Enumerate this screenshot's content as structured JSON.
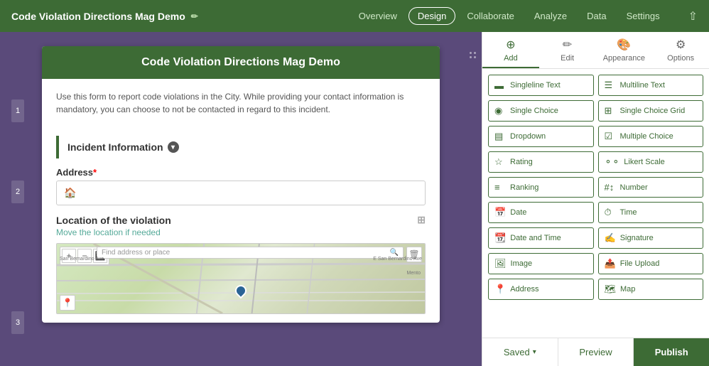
{
  "nav": {
    "title": "Code Violation Directions Mag Demo",
    "links": [
      {
        "id": "overview",
        "label": "Overview",
        "active": false
      },
      {
        "id": "design",
        "label": "Design",
        "active": true
      },
      {
        "id": "collaborate",
        "label": "Collaborate",
        "active": false
      },
      {
        "id": "analyze",
        "label": "Analyze",
        "active": false
      },
      {
        "id": "data",
        "label": "Data",
        "active": false
      },
      {
        "id": "settings",
        "label": "Settings",
        "active": false
      }
    ]
  },
  "form": {
    "title": "Code Violation Directions Mag Demo",
    "description": "Use this form to report code violations in the City. While providing your contact information is mandatory, you can choose to not be contacted in regard to this incident.",
    "section1_title": "Incident Information",
    "field_address_label": "Address",
    "field_address_placeholder": "🏠",
    "location_title": "Location of the violation",
    "location_subtitle": "Move the location if needed",
    "map_search_placeholder": "Find address or place",
    "map_label_san_bernardino": "San Bernardino Ave",
    "map_label_e_san_bernardino": "E San Bernardino Ave",
    "map_label_mento": "Mento",
    "section_numbers": [
      "1",
      "2",
      "3"
    ]
  },
  "panel": {
    "tabs": [
      {
        "id": "add",
        "label": "Add",
        "icon": "➕"
      },
      {
        "id": "edit",
        "label": "Edit",
        "icon": "✏️"
      },
      {
        "id": "appearance",
        "label": "Appearance",
        "icon": "🎨"
      },
      {
        "id": "options",
        "label": "Options",
        "icon": "⚙️"
      }
    ],
    "active_tab": "add",
    "fields": [
      {
        "id": "singleline",
        "label": "Singleline Text",
        "icon": "▬"
      },
      {
        "id": "multiline",
        "label": "Multiline Text",
        "icon": "☰"
      },
      {
        "id": "single-choice",
        "label": "Single Choice",
        "icon": "◉"
      },
      {
        "id": "single-choice-grid",
        "label": "Single Choice Grid",
        "icon": "⊞"
      },
      {
        "id": "dropdown",
        "label": "Dropdown",
        "icon": "▤"
      },
      {
        "id": "multiple-choice",
        "label": "Multiple Choice",
        "icon": "☑"
      },
      {
        "id": "rating",
        "label": "Rating",
        "icon": "☆"
      },
      {
        "id": "likert-scale",
        "label": "Likert Scale",
        "icon": "⚬⚬"
      },
      {
        "id": "ranking",
        "label": "Ranking",
        "icon": "≡"
      },
      {
        "id": "number",
        "label": "Number",
        "icon": "🔢"
      },
      {
        "id": "date",
        "label": "Date",
        "icon": "📅"
      },
      {
        "id": "time",
        "label": "Time",
        "icon": "⏱"
      },
      {
        "id": "date-and-time",
        "label": "Date and Time",
        "icon": "📆"
      },
      {
        "id": "signature",
        "label": "Signature",
        "icon": "✍"
      },
      {
        "id": "image",
        "label": "Image",
        "icon": "🖼"
      },
      {
        "id": "file-upload",
        "label": "File Upload",
        "icon": "📤"
      },
      {
        "id": "address",
        "label": "Address",
        "icon": "📍"
      },
      {
        "id": "map",
        "label": "Map",
        "icon": "🗺"
      }
    ]
  },
  "bottom_bar": {
    "saved_label": "Saved",
    "preview_label": "Preview",
    "publish_label": "Publish"
  }
}
